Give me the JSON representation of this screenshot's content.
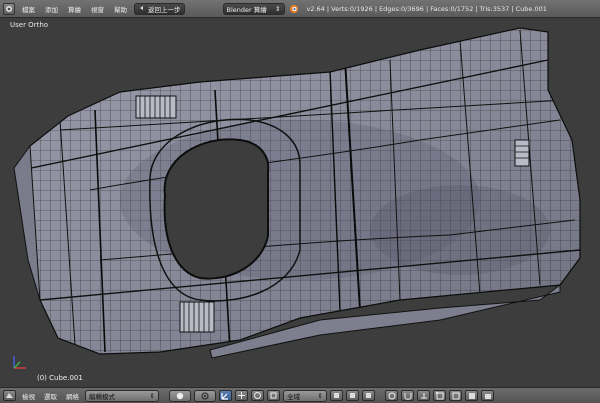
{
  "top": {
    "menus": [
      "檔案",
      "添加",
      "算繪",
      "視窗",
      "幫助"
    ],
    "undo_label": "返回上一步",
    "engine": "Blender 算繪",
    "stats": "v2.64 | Verts:0/1926 | Edges:0/3696 | Faces:0/1752 | Tris:3537 | Cube.001"
  },
  "viewport": {
    "view_name": "User Ortho",
    "object_label": "(0) Cube.001"
  },
  "bottom": {
    "menus": [
      "檢視",
      "選取",
      "網格"
    ],
    "mode": "編輯模式",
    "pivot": "全域"
  },
  "colors": {
    "mesh_fill": "#8e90a0",
    "mesh_dark": "#5a5c68",
    "wire": "#111111",
    "background": "#3d3d3d"
  }
}
